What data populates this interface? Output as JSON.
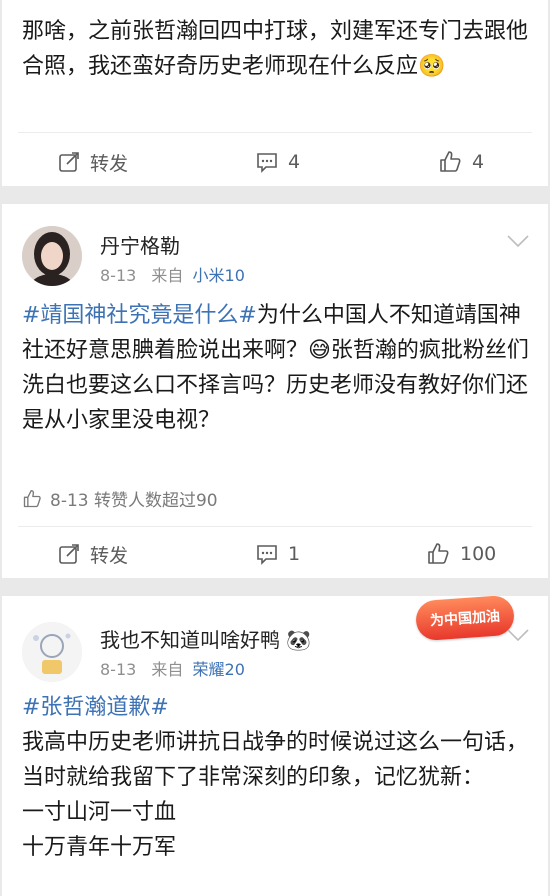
{
  "post1": {
    "text": "那啥，之前张哲瀚回四中打球，刘建军还专门去跟他合照，我还蛮好奇历史老师现在什么反应🥺",
    "actions": {
      "repost_label": "转发",
      "comments": "4",
      "likes": "4"
    }
  },
  "post2": {
    "user": "丹宁格勒",
    "date": "8-13",
    "from_label": "来自",
    "device": "小米10",
    "hashtag": "#靖国神社究竟是什么#",
    "text": "为什么中国人不知道靖国神社还好意思腆着脸说出来啊？😅张哲瀚的疯批粉丝们洗白也要这么口不择言吗？历史老师没有教好你们还是从小家里没电视？",
    "liked_line": "8-13 转赞人数超过90",
    "actions": {
      "repost_label": "转发",
      "comments": "1",
      "likes": "100"
    }
  },
  "post3": {
    "user": "我也不知道叫啥好鸭 🐼",
    "date": "8-13",
    "from_label": "来自",
    "device": "荣耀20",
    "badge": "为中国加油",
    "hashtag": "#张哲瀚道歉#",
    "text": "我高中历史老师讲抗日战争的时候说过这么一句话，当时就给我留下了非常深刻的印象，记忆犹新：\n一寸山河一寸血\n十万青年十万军"
  },
  "icons": [
    "repost-icon",
    "comment-icon",
    "like-icon",
    "chevron-down-icon"
  ],
  "colors": {
    "link": "#3d72b5",
    "badge": "#e8382c"
  }
}
